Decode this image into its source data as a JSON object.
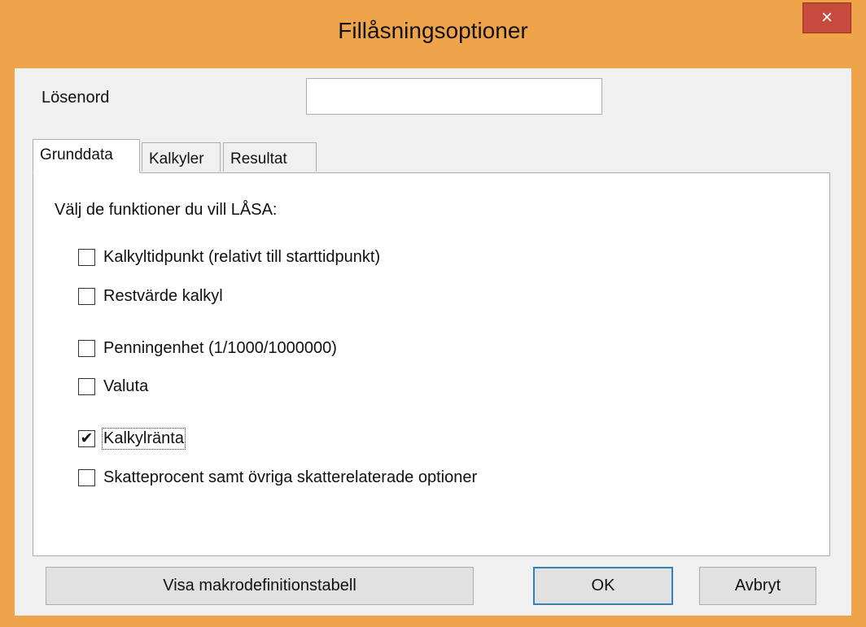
{
  "window": {
    "title": "Fillåsningsoptioner",
    "close_glyph": "×"
  },
  "password": {
    "label": "Lösenord",
    "value": ""
  },
  "tabs": [
    {
      "label": "Grunddata",
      "active": true
    },
    {
      "label": "Kalkyler",
      "active": false
    },
    {
      "label": "Resultat",
      "active": false
    }
  ],
  "panel": {
    "heading": "Välj de funktioner du vill LÅSA:",
    "options": [
      {
        "label": "Kalkyltidpunkt (relativt till starttidpunkt)",
        "checked": false,
        "mark": ""
      },
      {
        "label": "Restvärde kalkyl",
        "checked": false,
        "mark": ""
      },
      {
        "label": "Penningenhet (1/1000/1000000)",
        "checked": false,
        "mark": ""
      },
      {
        "label": "Valuta",
        "checked": false,
        "mark": ""
      },
      {
        "label": "Kalkylränta",
        "checked": true,
        "mark": "✔"
      },
      {
        "label": "Skatteprocent samt övriga skatterelaterade optioner",
        "checked": false,
        "mark": ""
      }
    ]
  },
  "buttons": {
    "macro_table": "Visa makrodefinitionstabell",
    "ok": "OK",
    "cancel": "Avbryt"
  },
  "colors": {
    "title_bar": "#f0a44a",
    "close_button": "#c74a3e"
  }
}
